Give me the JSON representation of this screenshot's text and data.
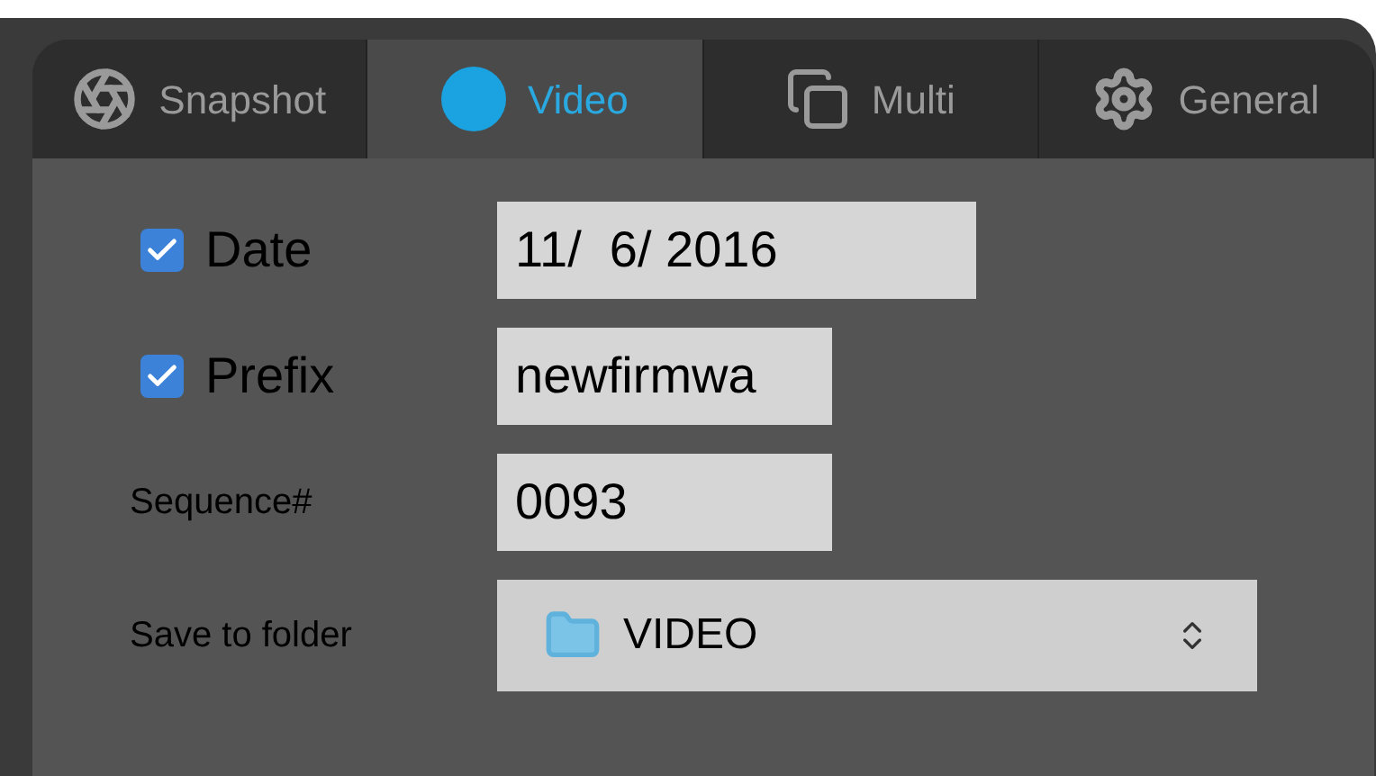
{
  "tabs": [
    {
      "label": "Snapshot",
      "kind": "aperture",
      "selected": false
    },
    {
      "label": "Video",
      "kind": "record",
      "selected": true
    },
    {
      "label": "Multi",
      "kind": "copy",
      "selected": false
    },
    {
      "label": "General",
      "kind": "gear",
      "selected": false
    }
  ],
  "fields": [
    {
      "kind": "check",
      "label": "Date",
      "checked": true,
      "value": "11/  6/ 2016"
    },
    {
      "kind": "check",
      "label": "Prefix",
      "checked": true,
      "value": "newfirmwa"
    },
    {
      "kind": "plain",
      "label": "Sequence#",
      "value": "0093"
    },
    {
      "kind": "select",
      "label": "Save to folder",
      "value": "VIDEO"
    }
  ]
}
